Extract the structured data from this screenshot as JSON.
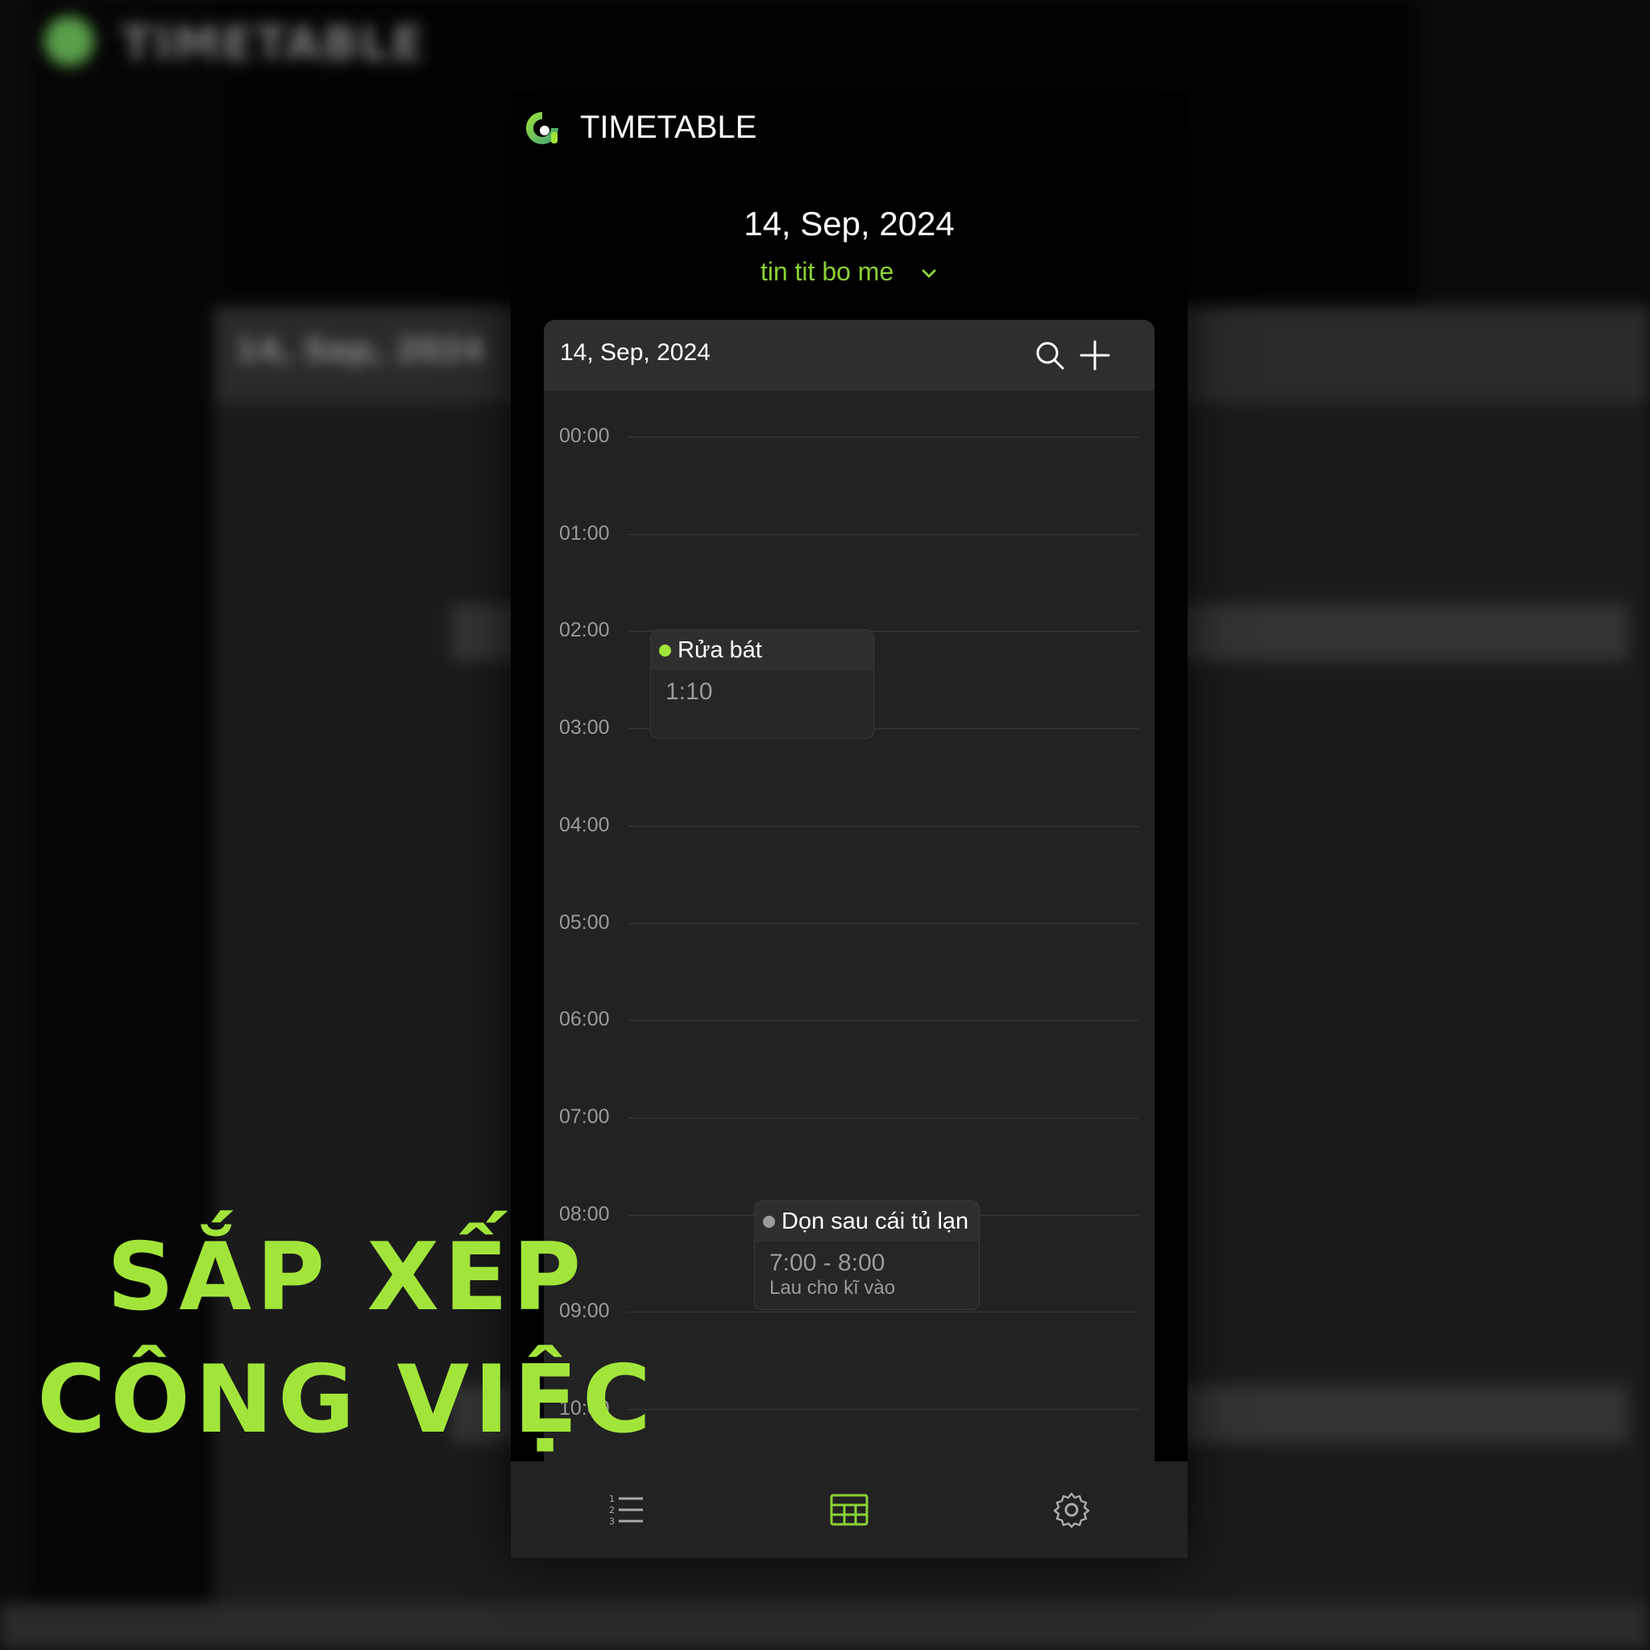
{
  "app": {
    "title": "TIMETABLE",
    "brand_color": "#8ad134"
  },
  "background": {
    "blurred_title": "TIMETABLE",
    "blurred_date": "14, Sep, 2024"
  },
  "header": {
    "date": "14, Sep, 2024",
    "selector_label": "tin tit bo me"
  },
  "calendar": {
    "date": "14, Sep, 2024",
    "search_icon": "search-icon",
    "add_icon": "plus-icon",
    "hours": [
      "00:00",
      "01:00",
      "02:00",
      "03:00",
      "04:00",
      "05:00",
      "06:00",
      "07:00",
      "08:00",
      "09:00",
      "10:00"
    ],
    "events": [
      {
        "title": "Rửa bát",
        "time": "1:10",
        "note": "",
        "dot_color": "#a2e53a"
      },
      {
        "title": "Dọn sau cái tủ lạn",
        "time": "7:00 - 8:00",
        "note": "Lau cho kĩ vào",
        "dot_color": "#9a9a9a"
      }
    ]
  },
  "nav": {
    "items": [
      {
        "name": "list-icon",
        "active": false
      },
      {
        "name": "table-icon",
        "active": true
      },
      {
        "name": "gear-icon",
        "active": false
      }
    ]
  },
  "caption": {
    "line1": "SẮP XẾP",
    "line2": "CÔNG VIỆC"
  }
}
